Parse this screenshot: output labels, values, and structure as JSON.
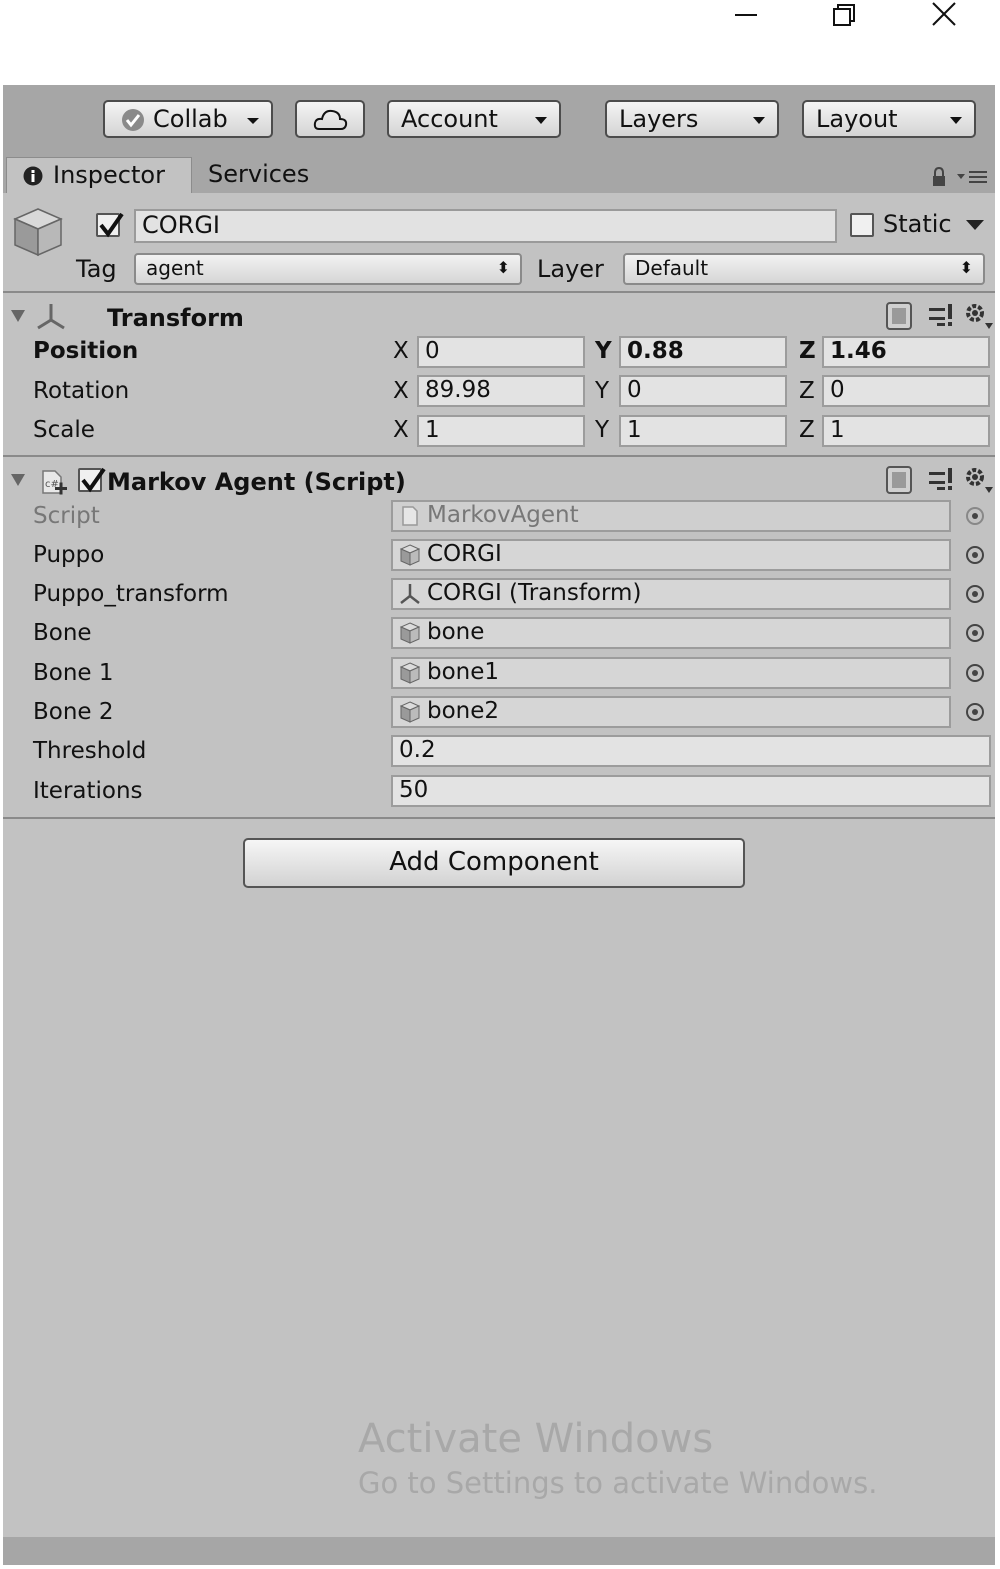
{
  "toolbar": {
    "collab_label": "Collab",
    "account_label": "Account",
    "layers_label": "Layers",
    "layout_label": "Layout"
  },
  "tabs": {
    "inspector_label": "Inspector",
    "services_label": "Services"
  },
  "object": {
    "active": true,
    "name": "CORGI",
    "static_label": "Static",
    "tag_label": "Tag",
    "tag_value": "agent",
    "layer_label": "Layer",
    "layer_value": "Default"
  },
  "transform": {
    "title": "Transform",
    "rows": [
      {
        "label": "Position",
        "x": "0",
        "y": "0.88",
        "z": "1.46"
      },
      {
        "label": "Rotation",
        "x": "89.98",
        "y": "0",
        "z": "0"
      },
      {
        "label": "Scale",
        "x": "1",
        "y": "1",
        "z": "1"
      }
    ],
    "axis_x": "X",
    "axis_y": "Y",
    "axis_z": "Z"
  },
  "script_component": {
    "title": "Markov Agent (Script)",
    "enabled": true,
    "fields": [
      {
        "label": "Script",
        "value": "MarkovAgent",
        "kind": "script"
      },
      {
        "label": "Puppo",
        "value": "CORGI",
        "kind": "gameobject"
      },
      {
        "label": "Puppo_transform",
        "value": "CORGI (Transform)",
        "kind": "transform"
      },
      {
        "label": "Bone",
        "value": "bone",
        "kind": "gameobject"
      },
      {
        "label": "Bone 1",
        "value": "bone1",
        "kind": "gameobject"
      },
      {
        "label": "Bone 2",
        "value": "bone2",
        "kind": "gameobject"
      },
      {
        "label": "Threshold",
        "value": "0.2",
        "kind": "number"
      },
      {
        "label": "Iterations",
        "value": "50",
        "kind": "number"
      }
    ]
  },
  "add_component_label": "Add Component",
  "watermark": {
    "title": "Activate Windows",
    "subtitle": "Go to Settings to activate Windows."
  },
  "colors": {
    "panel_bg": "#c2c2c2",
    "toolbar_bg": "#a6a6a6",
    "field_bg": "#e3e3e3"
  }
}
